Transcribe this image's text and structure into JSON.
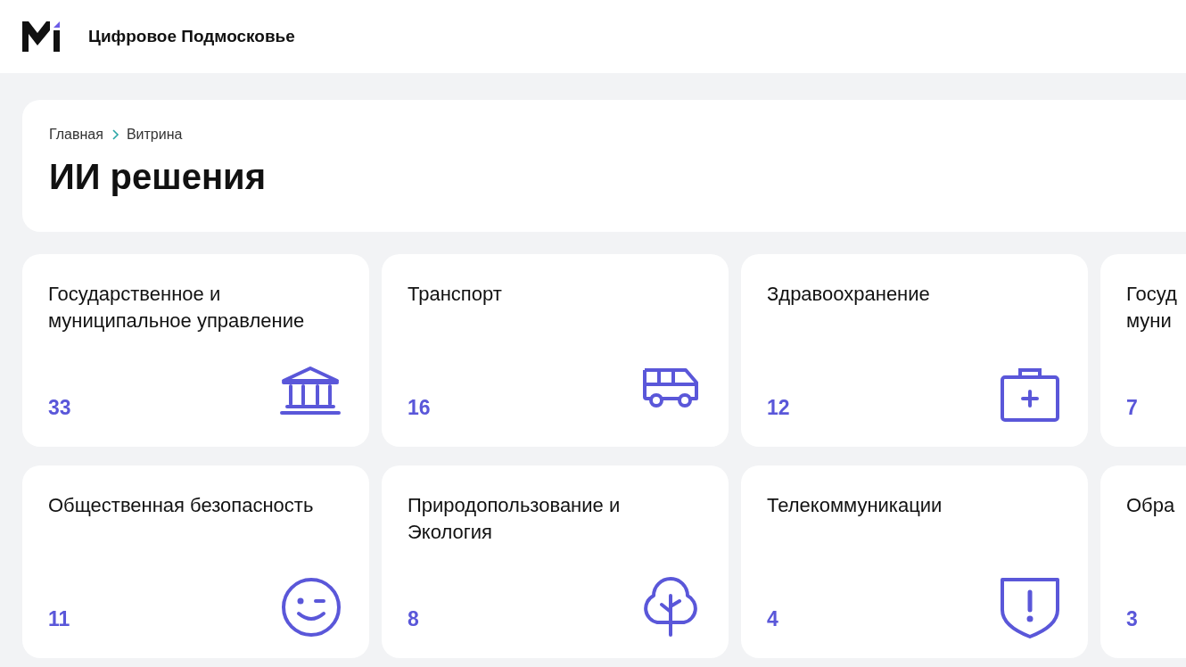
{
  "header": {
    "site_title": "Цифровое Подмосковье"
  },
  "breadcrumbs": [
    {
      "label": "Главная"
    },
    {
      "label": "Витрина"
    }
  ],
  "page_title": "ИИ решения",
  "categories": [
    {
      "title": "Государственное и муниципальное управление",
      "count": "33",
      "kind": "bank"
    },
    {
      "title": "Транспорт",
      "count": "16",
      "kind": "bus"
    },
    {
      "title": "Здравоохранение",
      "count": "12",
      "kind": "medkit"
    },
    {
      "title": "Госуд\nмуни",
      "count": "7",
      "kind": "clipped"
    },
    {
      "title": "Общественная безопасность",
      "count": "11",
      "kind": "smile"
    },
    {
      "title": "Природопользование и Экология",
      "count": "8",
      "kind": "tree"
    },
    {
      "title": "Телекоммуникации",
      "count": "4",
      "kind": "shield"
    },
    {
      "title": "Обра",
      "count": "3",
      "kind": "clipped"
    }
  ]
}
